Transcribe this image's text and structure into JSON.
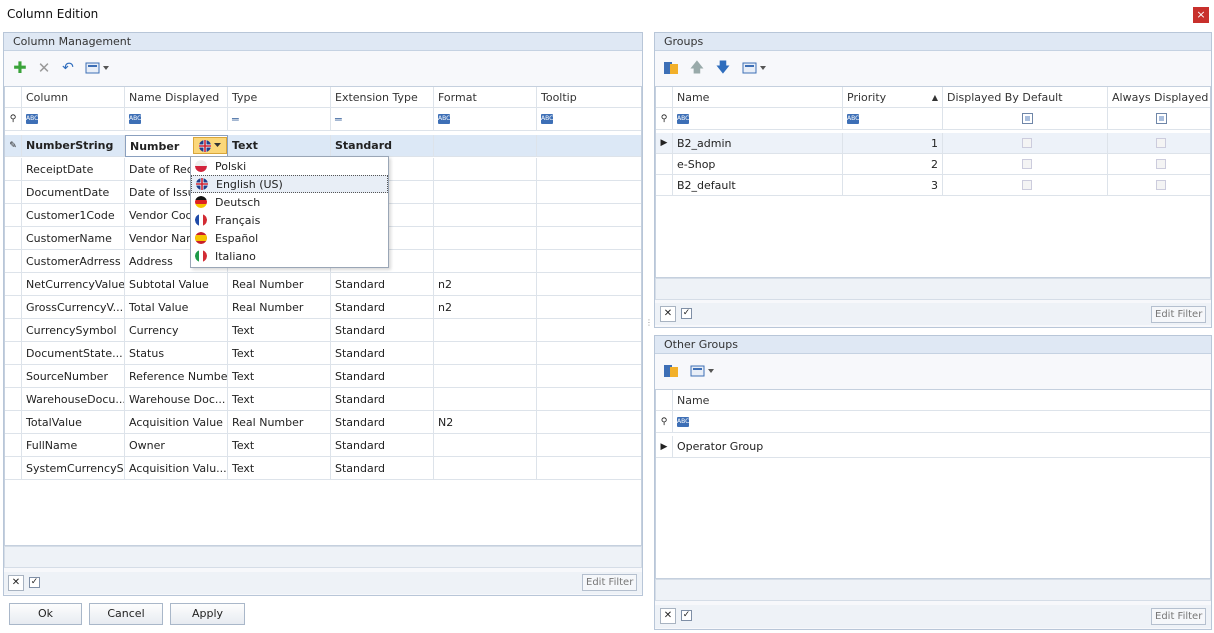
{
  "window": {
    "title": "Column Edition",
    "close_label": "×"
  },
  "column_management": {
    "title": "Column Management",
    "columns": [
      "Column",
      "Name Displayed",
      "Type",
      "Extension Type",
      "Format",
      "Tooltip"
    ],
    "editing_row": {
      "column": "NumberString",
      "name": "Number",
      "type": "Text",
      "ext": "Standard"
    },
    "rows": [
      {
        "column": "ReceiptDate",
        "name": "Date of Rece",
        "type": "",
        "ext": "",
        "format": ""
      },
      {
        "column": "DocumentDate",
        "name": "Date of Issu",
        "type": "",
        "ext": "",
        "format": ""
      },
      {
        "column": "Customer1Code",
        "name": "Vendor Cod",
        "type": "",
        "ext": "",
        "format": ""
      },
      {
        "column": "CustomerName",
        "name": "Vendor Nam",
        "type": "",
        "ext": "",
        "format": ""
      },
      {
        "column": "CustomerAdrress",
        "name": "Address",
        "type": "",
        "ext": "",
        "format": ""
      },
      {
        "column": "NetCurrencyValue",
        "name": "Subtotal Value",
        "type": "Real Number",
        "ext": "Standard",
        "format": "n2"
      },
      {
        "column": "GrossCurrencyV...",
        "name": "Total Value",
        "type": "Real Number",
        "ext": "Standard",
        "format": "n2"
      },
      {
        "column": "CurrencySymbol",
        "name": "Currency",
        "type": "Text",
        "ext": "Standard",
        "format": ""
      },
      {
        "column": "DocumentState...",
        "name": "Status",
        "type": "Text",
        "ext": "Standard",
        "format": ""
      },
      {
        "column": "SourceNumber",
        "name": "Reference Number",
        "type": "Text",
        "ext": "Standard",
        "format": ""
      },
      {
        "column": "WarehouseDocu...",
        "name": "Warehouse Doc...",
        "type": "Text",
        "ext": "Standard",
        "format": ""
      },
      {
        "column": "TotalValue",
        "name": "Acquisition Value",
        "type": "Real Number",
        "ext": "Standard",
        "format": "N2"
      },
      {
        "column": "FullName",
        "name": "Owner",
        "type": "Text",
        "ext": "Standard",
        "format": ""
      },
      {
        "column": "SystemCurrencyS...",
        "name": "Acquisition Valu...",
        "type": "Text",
        "ext": "Standard",
        "format": ""
      }
    ],
    "language_dropdown": [
      "Polski",
      "English (US)",
      "Deutsch",
      "Français",
      "Español",
      "Italiano"
    ],
    "edit_filter": "Edit Filter"
  },
  "groups": {
    "title": "Groups",
    "columns": [
      "Name",
      "Priority",
      "Displayed By Default",
      "Always Displayed"
    ],
    "rows": [
      {
        "name": "B2_admin",
        "priority": "1"
      },
      {
        "name": "e-Shop",
        "priority": "2"
      },
      {
        "name": "B2_default",
        "priority": "3"
      }
    ],
    "edit_filter": "Edit Filter"
  },
  "other_groups": {
    "title": "Other Groups",
    "columns": [
      "Name"
    ],
    "rows": [
      "Operator Group"
    ],
    "edit_filter": "Edit Filter"
  },
  "buttons": {
    "ok": "Ok",
    "cancel": "Cancel",
    "apply": "Apply"
  },
  "colors": {
    "accent": "#3d6fb6",
    "panel_header": "#dfe8f4",
    "close": "#c8302c",
    "selected_row": "#dce8f6"
  }
}
